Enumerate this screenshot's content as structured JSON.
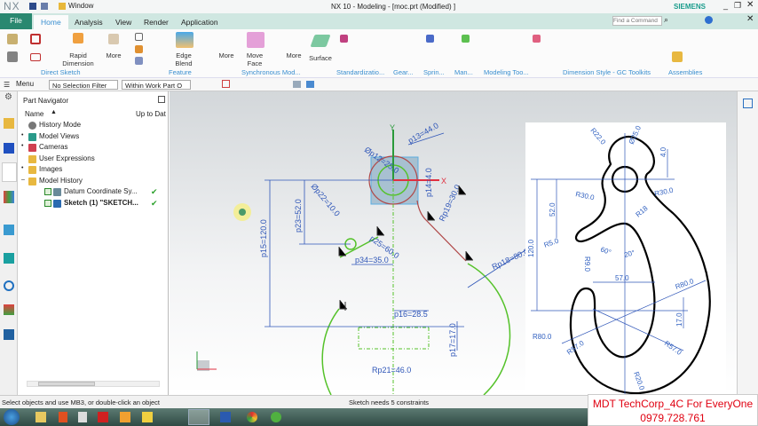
{
  "title_bar": {
    "logo": "NX",
    "window_menu": "Window",
    "title": "NX 10 - Modeling - [moc.prt (Modified) ]",
    "brand": "SIEMENS"
  },
  "tabs": [
    "File",
    "Home",
    "Analysis",
    "View",
    "Render",
    "Application"
  ],
  "active_tab": "Home",
  "find_command": {
    "placeholder": "Find a Command"
  },
  "ribbon": {
    "buttons": {
      "rapid_dimension": "Rapid Dimension",
      "more1": "More",
      "edge_blend": "Edge Blend",
      "more2": "More",
      "move_face": "Move Face",
      "more3": "More",
      "surface": "Surface"
    },
    "groups": [
      "Direct Sketch",
      "Feature",
      "Synchronous Mod...",
      "Standardizatio...",
      "Gear...",
      "Sprin...",
      "Man...",
      "Modeling Too...",
      "Dimension Style - GC Toolkits",
      "Assemblies"
    ]
  },
  "toolbar": {
    "menu": "Menu",
    "selection_filter": "No Selection Filter",
    "scope": "Within Work Part O"
  },
  "navigator": {
    "title": "Part Navigator",
    "columns": [
      "Name",
      "Up to Dat"
    ],
    "items": [
      {
        "label": "History Mode",
        "icon": "clock-icon"
      },
      {
        "label": "Model Views",
        "icon": "views-icon"
      },
      {
        "label": "Cameras",
        "icon": "camera-icon"
      },
      {
        "label": "User Expressions",
        "icon": "folder-icon"
      },
      {
        "label": "Images",
        "icon": "folder-icon"
      },
      {
        "label": "Model History",
        "icon": "folder-icon"
      },
      {
        "label": "Datum Coordinate Sy...",
        "icon": "datum-csys-icon",
        "checked": true,
        "up_to_date": true
      },
      {
        "label": "Sketch (1) \"SKETCH...",
        "icon": "sketch-icon",
        "checked": true,
        "up_to_date": true
      }
    ]
  },
  "sketch": {
    "dims": [
      "p13=44.0",
      "Øp12=25.0",
      "p14=4.0",
      "Rp19=30.0",
      "Øp22=10.0",
      "p23=52.0",
      "p15=120.0",
      "p25=60.0",
      "p34=35.0",
      "Rp18=80.0",
      "p16=28.5",
      "p17=17.0",
      "Rp21=46.0"
    ],
    "axis_x": "X",
    "axis_y": "Y"
  },
  "reference_drawing": {
    "dims": [
      "R22.0",
      "Ø25.0",
      "4.0",
      "R30.0",
      "R30.0",
      "52.0",
      "R18",
      "R5.0",
      "60°",
      "20°",
      "120.0",
      "R9.0",
      "57.0",
      "R80.0",
      "17.0",
      "R80.0",
      "R57.0",
      "R57.0",
      "R20.0"
    ]
  },
  "status": {
    "left": "Select objects and use MB3, or double-click an object",
    "center": "Sketch needs 5 constraints"
  },
  "watermark": {
    "line1": "MDT TechCorp_4C For EveryOne",
    "line2": "0979.728.761"
  },
  "colors": {
    "tab_bar": "#cfe7e1",
    "brand": "#1a9c8c",
    "file_tab": "#2a8870",
    "sketch_green": "#55c22a",
    "dim_blue": "#2f56b8",
    "watermark_red": "#e00010"
  }
}
